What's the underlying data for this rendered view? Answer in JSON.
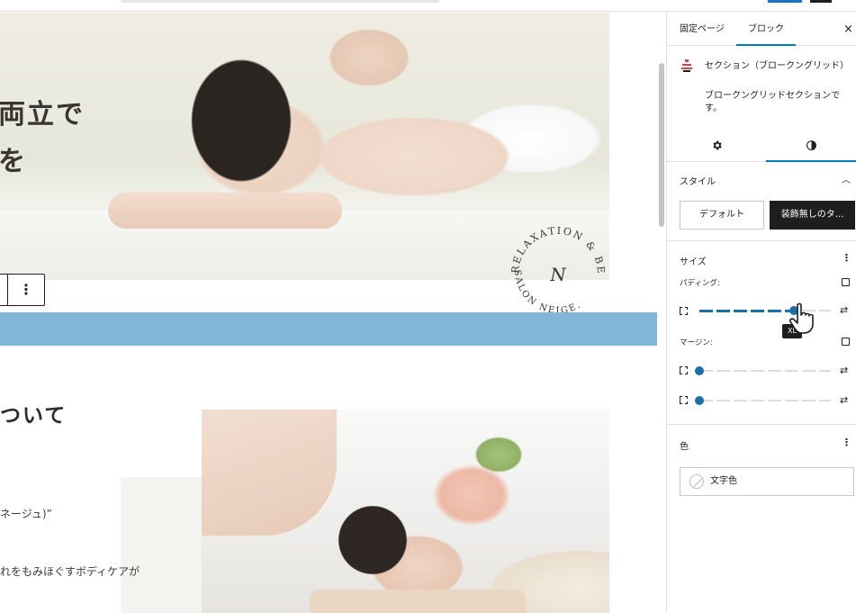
{
  "hero": {
    "heading_lines": [
      "両立で",
      "を"
    ],
    "seal_top_text": "RELAXATION & BEAUTY",
    "seal_bottom_text": "SALON NEIGE.",
    "seal_monogram": "N"
  },
  "toolbar": {
    "more_icon": "⋮"
  },
  "about": {
    "heading": "ついて",
    "body_line1": "ネージュ)”",
    "body_line2": "れをもみほぐすボディケアが"
  },
  "sidebar": {
    "tabs": {
      "page": "固定ページ",
      "block": "ブロック"
    },
    "close": "×",
    "block": {
      "title": "セクション（ブロークングリッド）",
      "description": "ブロークングリッドセクションです。"
    },
    "style_panel": {
      "title": "スタイル",
      "default_label": "デフォルト",
      "plain_label": "装飾無しのタ..."
    },
    "size_panel": {
      "title": "サイズ",
      "padding_label": "パディング:",
      "margin_label": "マージン:",
      "padding_level": 0.72,
      "margin_top_level": 0.0,
      "margin_bottom_level": 0.0,
      "tooltip": "XL"
    },
    "color_panel": {
      "title": "色",
      "text_color_label": "文字色"
    },
    "accent_color": "#007cba"
  }
}
